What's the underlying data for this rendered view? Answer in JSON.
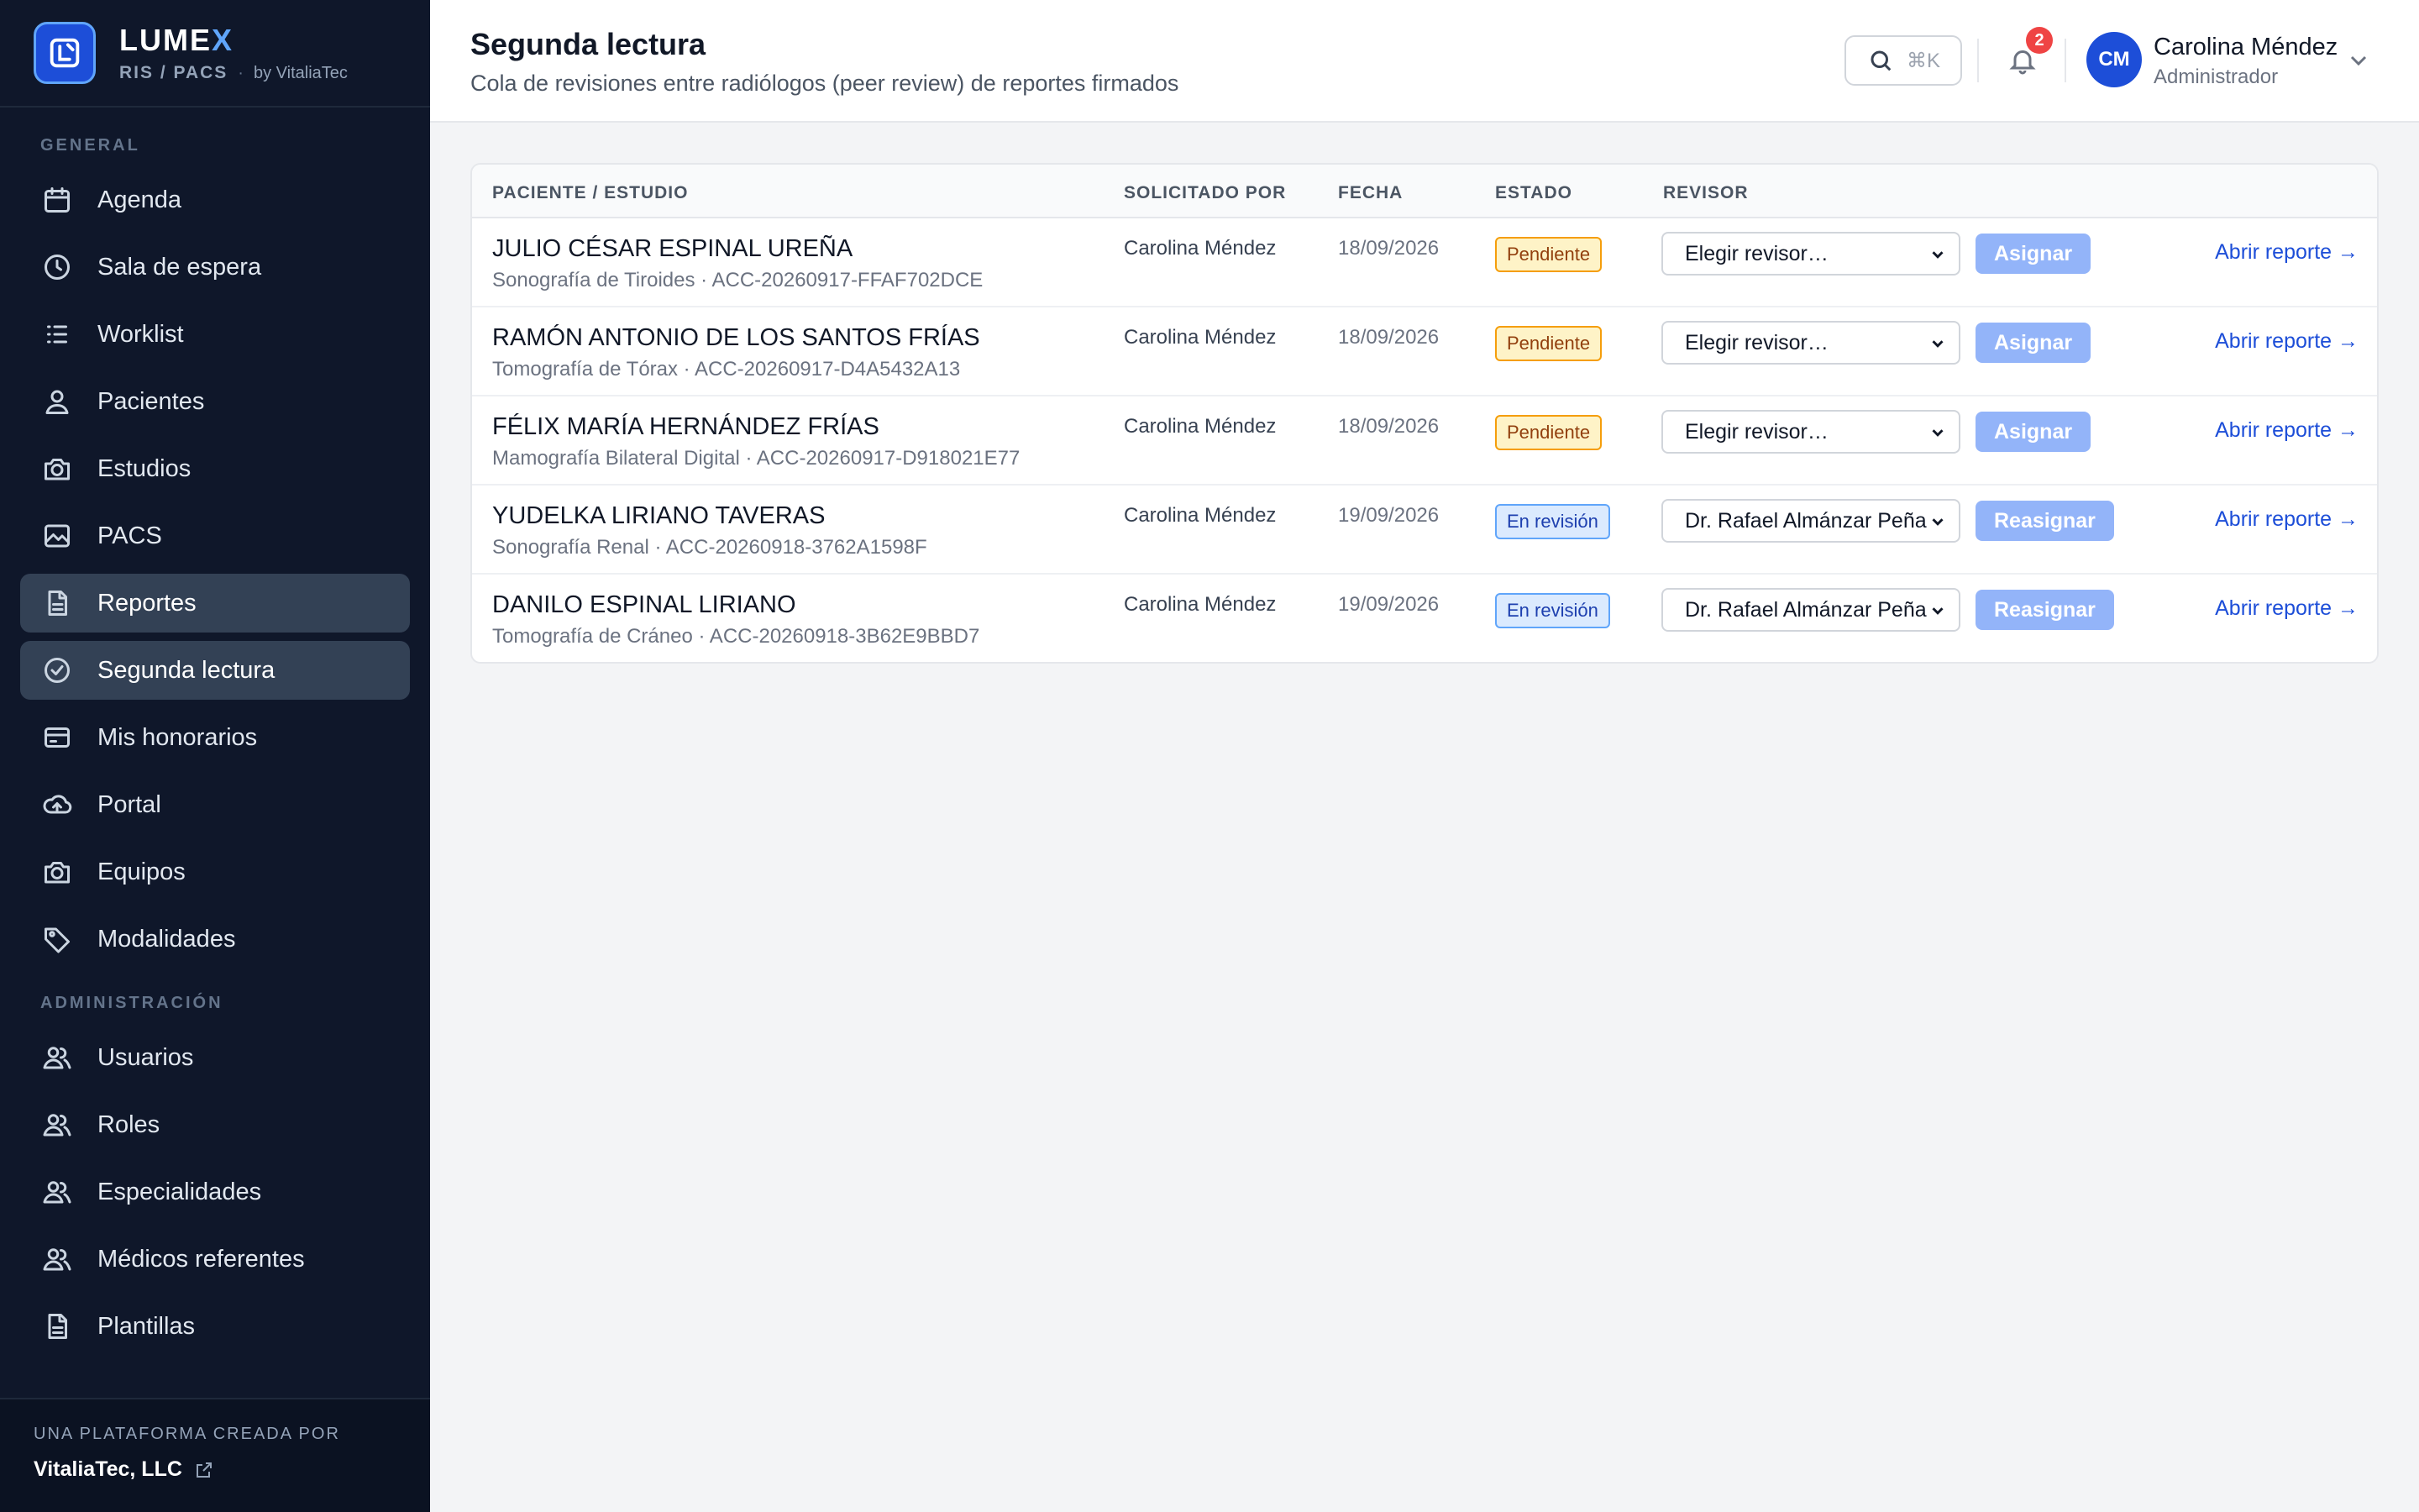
{
  "brand": {
    "name_main": "LUME",
    "name_accent": "X",
    "sub": "RIS / PACS",
    "by": "by VitaliaTec"
  },
  "sidebar": {
    "section_general": "GENERAL",
    "general_items": [
      {
        "label": "Agenda",
        "icon": "calendar-icon"
      },
      {
        "label": "Sala de espera",
        "icon": "clock-icon"
      },
      {
        "label": "Worklist",
        "icon": "list-icon"
      },
      {
        "label": "Pacientes",
        "icon": "user-icon"
      },
      {
        "label": "Estudios",
        "icon": "camera-icon"
      },
      {
        "label": "PACS",
        "icon": "image-icon"
      },
      {
        "label": "Reportes",
        "icon": "document-icon",
        "active": true
      },
      {
        "label": "Segunda lectura",
        "icon": "check-circle-icon",
        "active": true
      },
      {
        "label": "Mis honorarios",
        "icon": "credit-card-icon"
      },
      {
        "label": "Portal",
        "icon": "cloud-upload-icon"
      },
      {
        "label": "Equipos",
        "icon": "camera-icon"
      },
      {
        "label": "Modalidades",
        "icon": "tag-icon"
      }
    ],
    "section_admin": "ADMINISTRACIÓN",
    "admin_items": [
      {
        "label": "Usuarios",
        "icon": "users-icon"
      },
      {
        "label": "Roles",
        "icon": "users-icon"
      },
      {
        "label": "Especialidades",
        "icon": "users-icon"
      },
      {
        "label": "Médicos referentes",
        "icon": "users-icon"
      },
      {
        "label": "Plantillas",
        "icon": "document-icon"
      }
    ],
    "footer_label": "UNA PLATAFORMA CREADA POR",
    "footer_link": "VitaliaTec, LLC"
  },
  "header": {
    "title": "Segunda lectura",
    "subtitle": "Cola de revisiones entre radiólogos (peer review) de reportes firmados",
    "search_shortcut": "⌘K",
    "notifications_count": "2",
    "user_initials": "CM",
    "user_name": "Carolina Méndez",
    "user_role": "Administrador"
  },
  "table": {
    "columns": [
      "PACIENTE / ESTUDIO",
      "SOLICITADO POR",
      "FECHA",
      "ESTADO",
      "REVISOR"
    ],
    "rows": [
      {
        "patient": "JULIO CÉSAR ESPINAL UREÑA",
        "study": "Sonografía de Tiroides · ACC-20260917-FFAF702DCE",
        "requested_by": "Carolina Méndez",
        "date": "18/09/2026",
        "status": "Pendiente",
        "status_type": "pending",
        "reviewer": "Elegir revisor…",
        "action": "Asignar",
        "link": "Abrir reporte →"
      },
      {
        "patient": "RAMÓN ANTONIO DE LOS SANTOS FRÍAS",
        "study": "Tomografía de Tórax · ACC-20260917-D4A5432A13",
        "requested_by": "Carolina Méndez",
        "date": "18/09/2026",
        "status": "Pendiente",
        "status_type": "pending",
        "reviewer": "Elegir revisor…",
        "action": "Asignar",
        "link": "Abrir reporte →"
      },
      {
        "patient": "FÉLIX MARÍA HERNÁNDEZ FRÍAS",
        "study": "Mamografía Bilateral Digital · ACC-20260917-D918021E77",
        "requested_by": "Carolina Méndez",
        "date": "18/09/2026",
        "status": "Pendiente",
        "status_type": "pending",
        "reviewer": "Elegir revisor…",
        "action": "Asignar",
        "link": "Abrir reporte →"
      },
      {
        "patient": "YUDELKA LIRIANO TAVERAS",
        "study": "Sonografía Renal · ACC-20260918-3762A1598F",
        "requested_by": "Carolina Méndez",
        "date": "19/09/2026",
        "status": "En revisión",
        "status_type": "review",
        "reviewer": "Dr. Rafael Almánzar Peña",
        "action": "Reasignar",
        "link": "Abrir reporte →"
      },
      {
        "patient": "DANILO ESPINAL LIRIANO",
        "study": "Tomografía de Cráneo · ACC-20260918-3B62E9BBD7",
        "requested_by": "Carolina Méndez",
        "date": "19/09/2026",
        "status": "En revisión",
        "status_type": "review",
        "reviewer": "Dr. Rafael Almánzar Peña",
        "action": "Reasignar",
        "link": "Abrir reporte →"
      }
    ]
  },
  "colors": {
    "sidebar_bg": "#0f172a",
    "active_item": "#334155",
    "accent": "#1d4ed8",
    "pending": "#fef3c7",
    "review": "#dbeafe"
  }
}
